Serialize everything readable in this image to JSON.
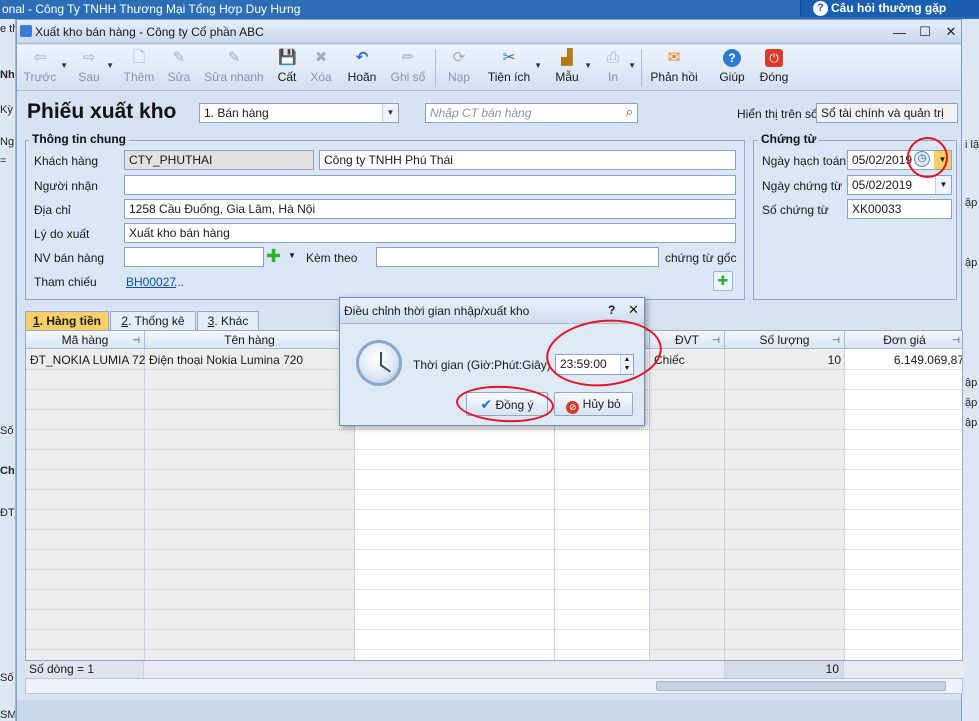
{
  "outer": {
    "title": "onal - Công Ty TNHH Thương Mại Tổng Hợp Duy Hưng",
    "help_label": "Câu hỏi thường gặp"
  },
  "left_strip": [
    "e th",
    "Nh",
    "Kỳ",
    "Ng",
    "=",
    "Số c",
    "Ch",
    "ĐT_",
    "Số",
    "SM"
  ],
  "right_strip": [
    "i lậ",
    "ập",
    "ập",
    "ập",
    "ập",
    "ập"
  ],
  "window": {
    "title": "Xuất kho bán hàng - Công ty Cổ phần ABC",
    "controls": [
      "—",
      "☐",
      "✕"
    ]
  },
  "toolbar": [
    {
      "label": "Trước",
      "icon": "⇦"
    },
    {
      "label": "Sau",
      "icon": "⇨"
    },
    {
      "label": "Thêm",
      "icon": "🗋"
    },
    {
      "label": "Sửa",
      "icon": "✎"
    },
    {
      "label": "Sửa nhanh",
      "icon": "✎"
    },
    {
      "label": "Cất",
      "icon": "💾"
    },
    {
      "label": "Xóa",
      "icon": "✖"
    },
    {
      "label": "Hoãn",
      "icon": "↶"
    },
    {
      "label": "Ghi sổ",
      "icon": "✏"
    },
    {
      "label": "Nạp",
      "icon": "⟳"
    },
    {
      "label": "Tiện ích",
      "icon": "✂"
    },
    {
      "label": "Mẫu",
      "icon": "▟"
    },
    {
      "label": "In",
      "icon": "⎙"
    },
    {
      "label": "Phản hồi",
      "icon": "✉"
    },
    {
      "label": "Giúp",
      "icon": "?"
    },
    {
      "label": "Đóng",
      "icon": "⏻"
    }
  ],
  "header": {
    "form_title": "Phiếu xuất kho",
    "type_value": "1. Bán hàng",
    "search_placeholder": "Nhập CT bán hàng",
    "display_label": "Hiển thị trên sổ",
    "display_value": "Sổ tài chính và quản trị"
  },
  "general": {
    "group_title": "Thông tin chung",
    "customer_label": "Khách hàng",
    "customer_code": "CTY_PHUTHAI",
    "customer_name": "Công ty TNHH Phú Thái",
    "receiver_label": "Người nhận",
    "receiver_value": "",
    "address_label": "Địa chỉ",
    "address_value": "1258 Cầu Đuống, Gia Lâm, Hà Nội",
    "reason_label": "Lý do xuất",
    "reason_value": "Xuất kho bán hàng",
    "sales_label": "NV bán hàng",
    "attach_label": "Kèm theo",
    "original_label": "chứng từ gốc",
    "ref_label": "Tham chiếu",
    "ref_value": "BH00027",
    "ref_more": "..."
  },
  "voucher": {
    "group_title": "Chứng từ",
    "posting_date_label": "Ngày hạch toán",
    "posting_date": "05/02/2019",
    "voucher_date_label": "Ngày chứng từ",
    "voucher_date": "05/02/2019",
    "voucher_no_label": "Số chứng từ",
    "voucher_no": "XK00033"
  },
  "tabs": [
    {
      "num": "1",
      "label": ". Hàng tiền"
    },
    {
      "num": "2",
      "label": ". Thống kê"
    },
    {
      "num": "3",
      "label": ". Khác"
    }
  ],
  "grid": {
    "headers": {
      "code": "Mã hàng",
      "name": "Tên hàng",
      "unit": "ĐVT",
      "qty": "Số lượng",
      "price": "Đơn giá"
    },
    "rows": [
      {
        "code": "ĐT_NOKIA LUMIA 72",
        "name": "Điện thoại Nokia Lumina 720",
        "unit": "Chiếc",
        "qty": "10",
        "price": "6.149.069,87"
      }
    ],
    "footer_rows": "Số dòng = 1",
    "footer_qty": "10"
  },
  "dialog": {
    "title": "Điều chỉnh thời gian nhập/xuất kho",
    "help": "?",
    "close": "✕",
    "time_label": "Thời gian (Giờ:Phút:Giây)",
    "time_value": "23:59:00",
    "ok_label": "Đồng ý",
    "cancel_label": "Hủy bỏ"
  },
  "colors": {
    "accent_tab": "#f7cf66",
    "annotation": "#e3142a",
    "title_bar": "#2d6fb7"
  }
}
